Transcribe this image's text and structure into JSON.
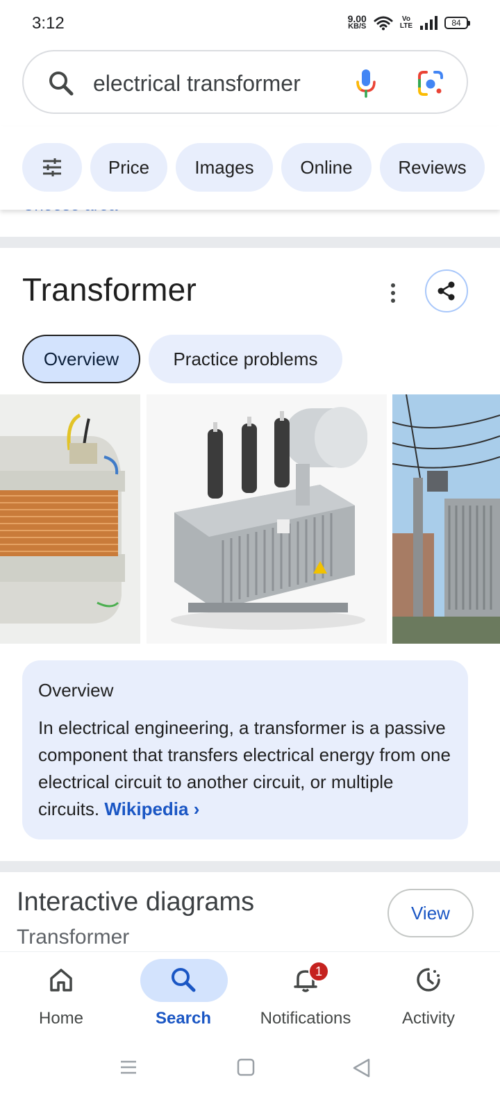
{
  "status_bar": {
    "time": "3:12",
    "net_speed_value": "9.00",
    "net_speed_unit": "KB/S",
    "volte_top": "Vo",
    "volte_bottom": "LTE",
    "battery": "84"
  },
  "search": {
    "query": "electrical transformer",
    "icons": [
      "search-icon",
      "mic-icon",
      "google-lens-icon"
    ]
  },
  "chips": {
    "filter_icon": "tune-sliders-icon",
    "items": [
      "Price",
      "Images",
      "Online",
      "Reviews"
    ]
  },
  "partial_link": "Choose area",
  "knowledge_panel": {
    "title": "Transformer",
    "tabs": {
      "overview": "Overview",
      "practice": "Practice problems"
    },
    "overview_card": {
      "heading": "Overview",
      "text": "In electrical engineering, a transformer is a passive component that transfers electrical energy from one electrical circuit to another circuit, or multiple circuits.",
      "link": "Wikipedia",
      "link_chevron": "›"
    }
  },
  "diagrams": {
    "title": "Interactive diagrams",
    "subtitle": "Transformer",
    "view_label": "View"
  },
  "bottom_nav": {
    "home": "Home",
    "search": "Search",
    "notifications": "Notifications",
    "notifications_badge": "1",
    "activity": "Activity"
  },
  "colors": {
    "accent": "#1a56c4",
    "chip_bg": "#e8eefc",
    "active_tab_bg": "#d3e3fd",
    "badge": "#c5221f"
  }
}
